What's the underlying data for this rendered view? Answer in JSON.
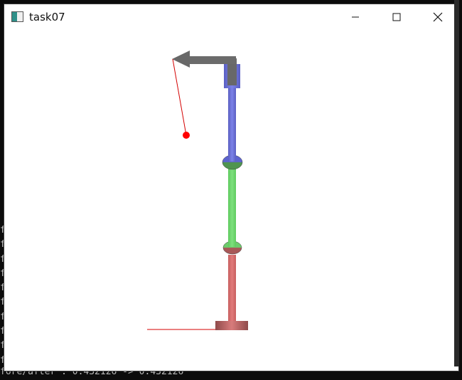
{
  "window": {
    "title": "task07"
  },
  "terminal": {
    "left_lines": [
      "f",
      "f",
      "f",
      "f",
      "f",
      "f",
      "f",
      "f",
      "f",
      "f"
    ],
    "bottom_text": "fore/after : 0.432126 -> 0.432126"
  },
  "scene": {
    "colors": {
      "upper_link": "#6f74d8",
      "middle_link": "#6fd36f",
      "lower_link": "#d66f6f",
      "arrow": "#6b6b6b",
      "target": "#ff0000",
      "line": "#d40000"
    }
  }
}
